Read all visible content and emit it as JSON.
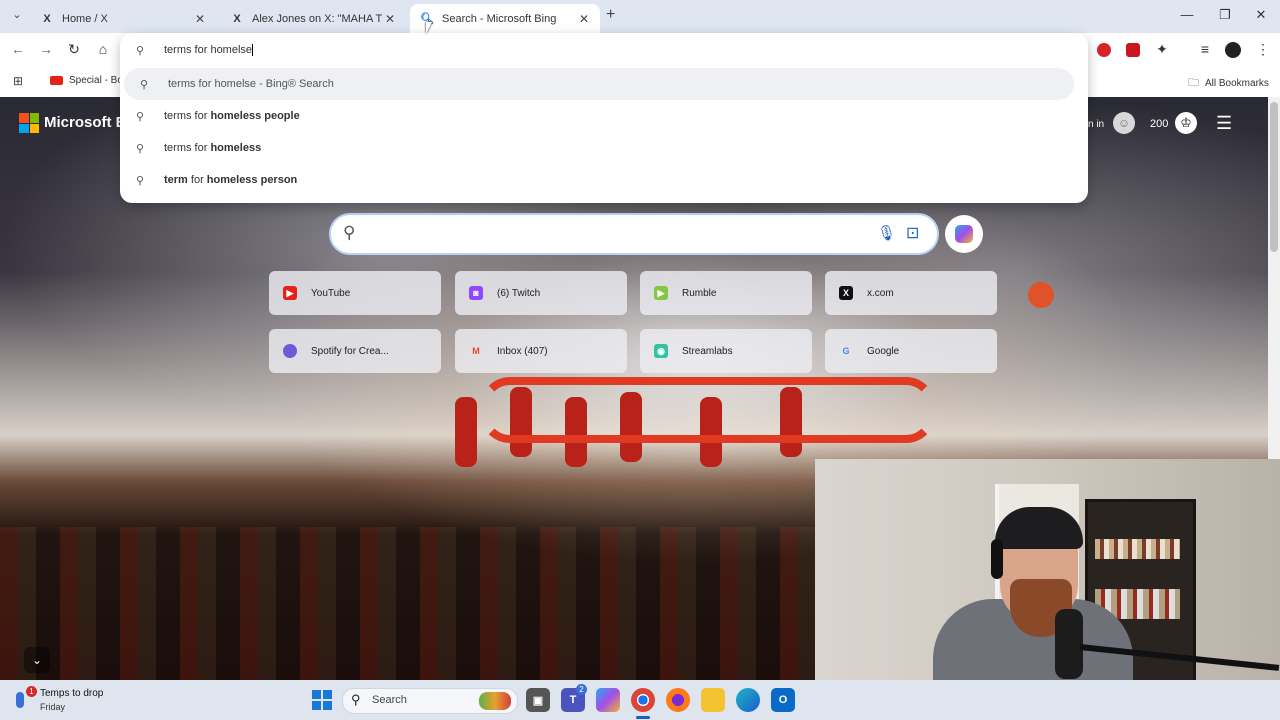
{
  "browser": {
    "tabs": [
      {
        "title": "Home / X",
        "icon": "x-icon",
        "active": false
      },
      {
        "title": "Alex Jones on X: \"MAHA TRUTH",
        "icon": "x-icon",
        "active": false
      },
      {
        "title": "Search - Microsoft Bing",
        "icon": "search-icon",
        "active": true
      }
    ],
    "address_value": "terms for homelse",
    "suggestions": [
      {
        "pre": "terms for homelse - Bing® Search",
        "bold": "",
        "post": ""
      },
      {
        "pre": "terms for ",
        "bold": "homeless people",
        "post": ""
      },
      {
        "pre": "terms for ",
        "bold": "homeless",
        "post": ""
      },
      {
        "pre": "",
        "bold": "term",
        "post": " for ",
        "bold2": "homeless person"
      }
    ],
    "bookmarks": {
      "special": "Special - Bo",
      "all": "All Bookmarks"
    },
    "extension_count": ""
  },
  "bing": {
    "logo_text": "Microsoft B",
    "sign_in": "n in",
    "points": "200"
  },
  "tiles": [
    {
      "label": "YouTube",
      "color": "#e62117",
      "glyph": "▶"
    },
    {
      "label": "(6) Twitch",
      "color": "#9146ff",
      "glyph": "◙"
    },
    {
      "label": "Rumble",
      "color": "#85c742",
      "glyph": "▶"
    },
    {
      "label": "x.com",
      "color": "#111111",
      "glyph": "X"
    },
    {
      "label": "Spotify for Crea...",
      "color": "#6a5cd8",
      "glyph": "●"
    },
    {
      "label": "Inbox (407)",
      "color": "#ea4335",
      "glyph": "M"
    },
    {
      "label": "Streamlabs",
      "color": "#31c3a2",
      "glyph": "◉"
    },
    {
      "label": "Google",
      "color": "#4285f4",
      "glyph": "G"
    }
  ],
  "taskbar": {
    "weather_title": "Temps to drop",
    "weather_sub": "Friday",
    "weather_badge": "1",
    "search_label": "Search",
    "teams_badge": "2"
  }
}
